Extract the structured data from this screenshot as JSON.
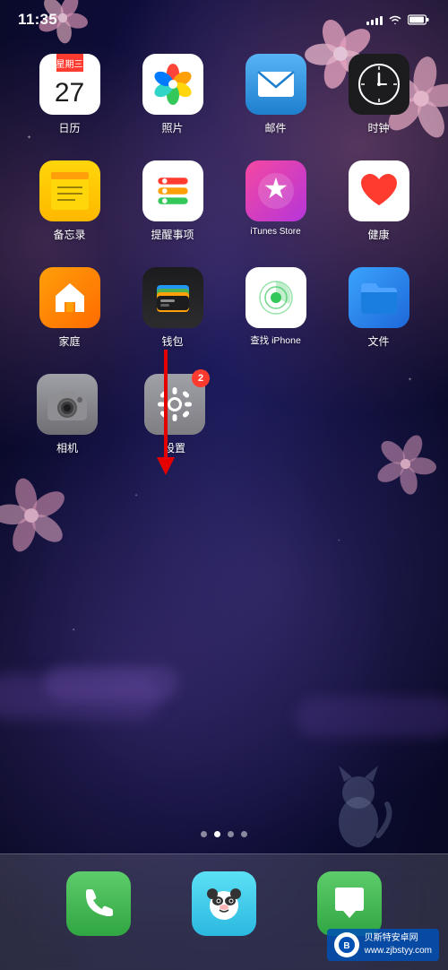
{
  "status_bar": {
    "time": "11:35",
    "signal_bars": 4,
    "wifi": true,
    "battery": "full"
  },
  "apps": {
    "row1": [
      {
        "id": "calendar",
        "label": "日历",
        "day_of_week": "星期三",
        "date": "27"
      },
      {
        "id": "photos",
        "label": "照片"
      },
      {
        "id": "mail",
        "label": "邮件"
      },
      {
        "id": "clock",
        "label": "时钟"
      }
    ],
    "row2": [
      {
        "id": "notes",
        "label": "备忘录"
      },
      {
        "id": "reminders",
        "label": "提醒事项"
      },
      {
        "id": "itunes",
        "label": "iTunes Store"
      },
      {
        "id": "health",
        "label": "健康"
      }
    ],
    "row3": [
      {
        "id": "home",
        "label": "家庭"
      },
      {
        "id": "wallet",
        "label": "钱包"
      },
      {
        "id": "find",
        "label": "查找 iPhone"
      },
      {
        "id": "files",
        "label": "文件"
      }
    ],
    "row4": [
      {
        "id": "camera",
        "label": "相机"
      },
      {
        "id": "settings",
        "label": "设置",
        "badge": "2"
      }
    ]
  },
  "dock": [
    {
      "id": "phone",
      "label": ""
    },
    {
      "id": "panda",
      "label": ""
    },
    {
      "id": "messages",
      "label": ""
    }
  ],
  "page_dots": {
    "count": 4,
    "active": 1
  },
  "annotation": {
    "type": "arrow",
    "color": "#e50000",
    "pointing_to": "settings"
  },
  "watermark": {
    "line1": "贝斯特安卓网",
    "line2": "www.zjbstyy.com"
  }
}
